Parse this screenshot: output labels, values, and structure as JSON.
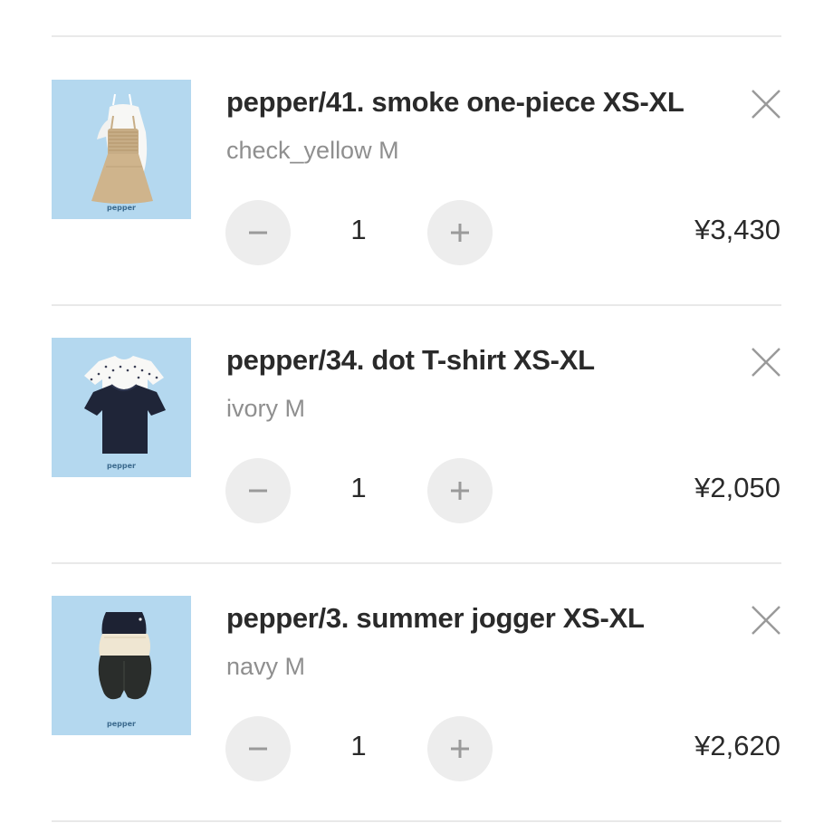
{
  "cart": {
    "items": [
      {
        "title": "pepper/41. smoke one-piece XS-XL",
        "variant": "check_yellow M",
        "quantity": "1",
        "price": "¥3,430",
        "brand": "pepper",
        "image": "beige smocked dress with white top"
      },
      {
        "title": "pepper/34. dot T-shirt XS-XL",
        "variant": "ivory M",
        "quantity": "1",
        "price": "¥2,050",
        "brand": "pepper",
        "image": "dotted ivory and navy t-shirts"
      },
      {
        "title": "pepper/3. summer jogger XS-XL",
        "variant": "navy M",
        "quantity": "1",
        "price": "¥2,620",
        "brand": "pepper",
        "image": "stacked navy, cream and black joggers"
      }
    ],
    "icons": {
      "remove": "close-icon",
      "decrement": "minus-icon",
      "increment": "plus-icon"
    },
    "colors": {
      "thumb_background": "#b4d8ef",
      "button_background": "#ededed",
      "divider": "#e9e9e9",
      "variant_text": "#8f8f8f"
    }
  }
}
